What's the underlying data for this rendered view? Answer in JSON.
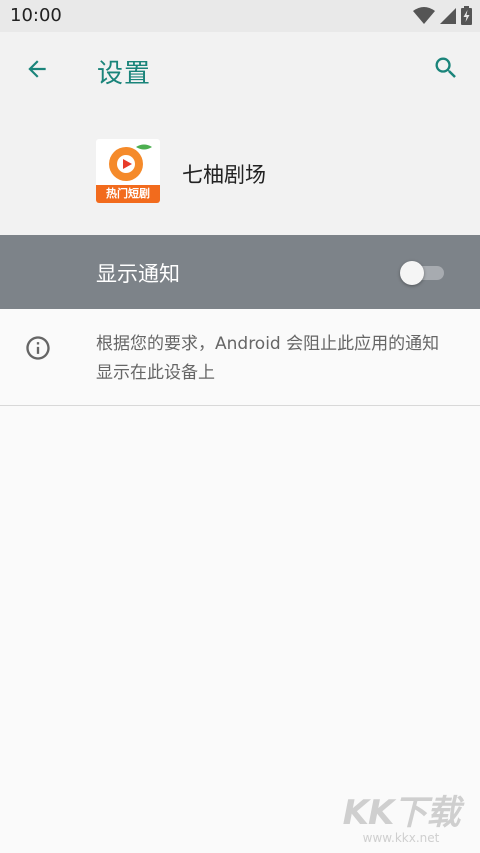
{
  "status_bar": {
    "time": "10:00"
  },
  "app_bar": {
    "title": "设置",
    "back_icon": "arrow-left-icon",
    "search_icon": "search-icon"
  },
  "app": {
    "name": "七柚剧场",
    "icon_badge": "热门短剧"
  },
  "notification": {
    "label": "显示通知",
    "enabled": false
  },
  "info": {
    "text": "根据您的要求，Android 会阻止此应用的通知显示在此设备上",
    "icon": "info-icon"
  },
  "watermark": {
    "main": "KK下载",
    "sub": "www.kkx.net"
  },
  "colors": {
    "accent": "#1a847a",
    "row_highlight": "#7d8389",
    "badge": "#f26b1d"
  }
}
